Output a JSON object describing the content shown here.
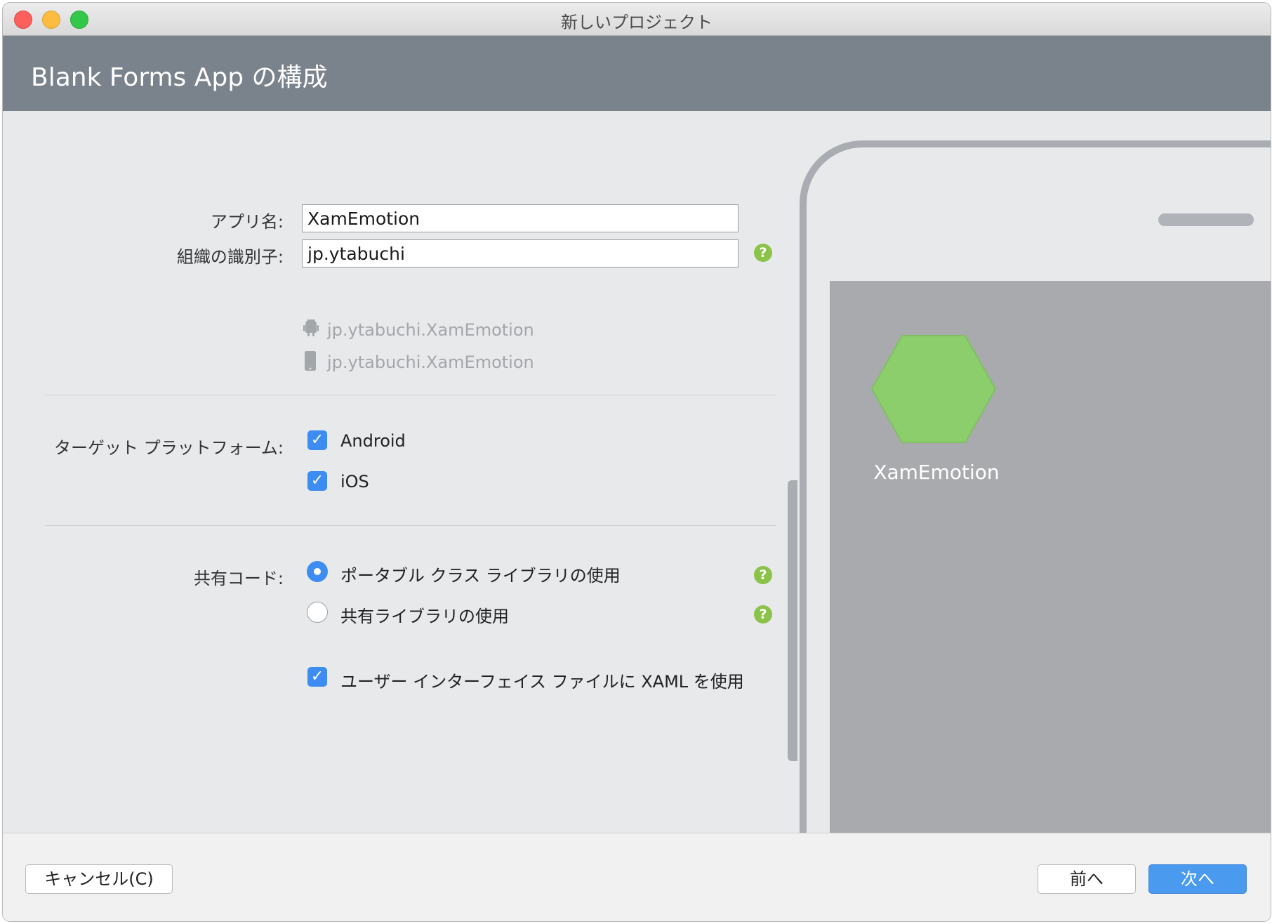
{
  "window": {
    "title": "新しいプロジェクト"
  },
  "header": {
    "title": "Blank Forms App の構成"
  },
  "form": {
    "app_name_label": "アプリ名:",
    "app_name_value": "XamEmotion",
    "org_id_label": "組織の識別子:",
    "org_id_value": "jp.ytabuchi",
    "android_bundle": "jp.ytabuchi.XamEmotion",
    "ios_bundle": "jp.ytabuchi.XamEmotion",
    "target_label": "ターゲット プラットフォーム:",
    "targets": [
      {
        "label": "Android",
        "checked": true
      },
      {
        "label": "iOS",
        "checked": true
      }
    ],
    "shared_code_label": "共有コード:",
    "shared_code_options": [
      {
        "label": "ポータブル クラス ライブラリの使用",
        "selected": true
      },
      {
        "label": "共有ライブラリの使用",
        "selected": false
      }
    ],
    "xaml_label": "ユーザー インターフェイス ファイルに XAML を使用",
    "xaml_checked": true,
    "help_glyph": "?"
  },
  "preview": {
    "app_name": "XamEmotion",
    "icon_color": "#8bce6b"
  },
  "footer": {
    "cancel": "キャンセル(C)",
    "back": "前へ",
    "next": "次へ"
  },
  "colors": {
    "accent": "#3d8cf2",
    "header": "#7a828c",
    "help": "#8bc34a"
  }
}
